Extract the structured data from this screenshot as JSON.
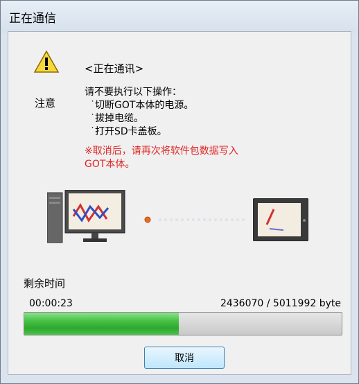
{
  "window": {
    "title": "正在通信"
  },
  "dialog": {
    "heading": "<正在通讯>",
    "note_label": "注意",
    "instructions": [
      "请不要执行以下操作：",
      "˙切断GOT本体的电源。",
      "˙拔掉电缆。",
      "˙打开SD卡盖板。"
    ],
    "warning_lines": [
      "※取消后，请再次将软件包数据写入",
      "GOT本体。"
    ]
  },
  "progress": {
    "remaining_label": "剩余时间",
    "time_remaining": "00:00:23",
    "bytes_text": "2436070 / 5011992 byte",
    "fraction": 0.486
  },
  "buttons": {
    "cancel_label": "取消"
  },
  "icons": {
    "warning": "warning-triangle-icon",
    "pc": "computer-icon",
    "got": "got-panel-icon"
  },
  "colors": {
    "warning_text": "#e02424",
    "progress_green": "#2ca82c",
    "transfer_dot": "#e07020"
  }
}
